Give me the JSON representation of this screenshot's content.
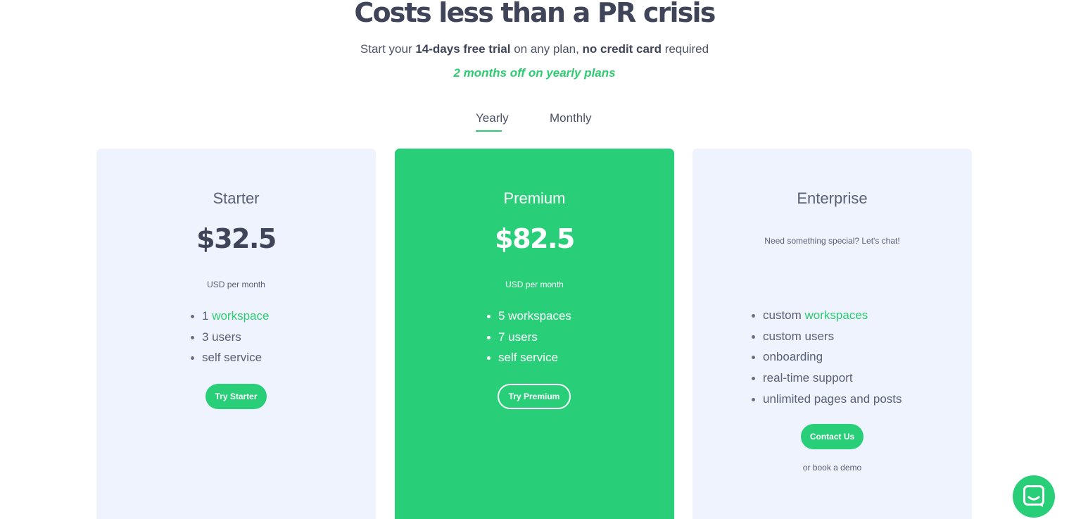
{
  "header": {
    "title": "Costs less than a PR crisis",
    "subtitle_prefix": "Start your ",
    "subtitle_trial": "14-days free trial",
    "subtitle_middle": " on any plan, ",
    "subtitle_no_card": "no credit card",
    "subtitle_suffix": " required",
    "promo": "2 months off on yearly plans"
  },
  "billing_tabs": {
    "active": "Yearly",
    "items": [
      {
        "label": "Yearly"
      },
      {
        "label": "Monthly"
      }
    ]
  },
  "plans": {
    "starter": {
      "name": "Starter",
      "price": "$32.5",
      "period": "USD per month",
      "features": [
        {
          "prefix": "1 ",
          "highlight": "workspace"
        },
        {
          "text": "3 users"
        },
        {
          "text": "self service"
        }
      ],
      "cta": "Try Starter"
    },
    "premium": {
      "name": "Premium",
      "price": "$82.5",
      "period": "USD per month",
      "features": [
        {
          "text": "5 workspaces"
        },
        {
          "text": "7 users"
        },
        {
          "text": "self service"
        }
      ],
      "cta": "Try Premium"
    },
    "enterprise": {
      "name": "Enterprise",
      "tagline": "Need something special? Let's chat!",
      "features": [
        {
          "prefix": "custom ",
          "highlight": "workspaces"
        },
        {
          "text": "custom users"
        },
        {
          "text": "onboarding"
        },
        {
          "text": "real-time support"
        },
        {
          "text": "unlimited pages and posts"
        }
      ],
      "cta": "Contact Us",
      "secondary_link": "or book a demo"
    }
  },
  "chat_launcher": {
    "icon": "chat-bubble-icon"
  },
  "colors": {
    "accent_green": "#29ce78",
    "card_background": "#eef3fd",
    "heading": "#3f4459"
  }
}
